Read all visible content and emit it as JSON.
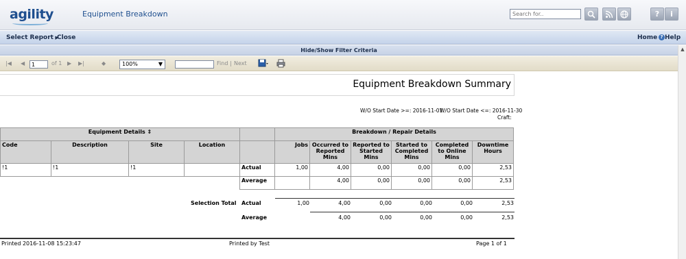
{
  "header": {
    "logo_text": "agility",
    "title": "Equipment Breakdown",
    "search_placeholder": "Search for..",
    "icons": [
      "search-icon",
      "rss-icon",
      "globe-icon",
      "help-icon",
      "info-icon"
    ]
  },
  "menu": {
    "select_report": "Select Report",
    "close": "Close",
    "home": "Home",
    "help": "Help"
  },
  "filter_bar": "Hide/Show Filter Criteria",
  "toolbar": {
    "page": "1",
    "of_label": "of 1",
    "zoom": "100%",
    "find": "Find",
    "separator": "|",
    "next": "Next"
  },
  "report": {
    "title": "Equipment Breakdown Summary",
    "start_date_from": "W/O Start Date >=: 2016-11-01",
    "start_date_to": "W/O Start Date <=: 2016-11-30",
    "craft": "Craft:",
    "group_headers": {
      "equipment": "Equipment Details",
      "breakdown": "Breakdown / Repair Details"
    },
    "columns": {
      "code": "Code",
      "description": "Description",
      "site": "Site",
      "location": "Location",
      "jobs": "Jobs",
      "occurred": "Occurred to Reported Mins",
      "reported": "Reported to Started Mins",
      "started": "Started to Completed Mins",
      "completed": "Completed to Online Mins",
      "downtime": "Downtime Hours"
    },
    "row": {
      "code": "!1",
      "description": "!1",
      "site": "!1",
      "location": "",
      "actual_label": "Actual",
      "actual": [
        "1,00",
        "4,00",
        "0,00",
        "0,00",
        "0,00",
        "2,53"
      ],
      "average_label": "Average",
      "average": [
        "",
        "4,00",
        "0,00",
        "0,00",
        "0,00",
        "2,53"
      ]
    },
    "totals": {
      "label": "Selection Total",
      "actual_label": "Actual",
      "actual": [
        "1,00",
        "4,00",
        "0,00",
        "0,00",
        "0,00",
        "2,53"
      ],
      "average_label": "Average",
      "average": [
        "4,00",
        "0,00",
        "0,00",
        "0,00",
        "2,53"
      ]
    },
    "footer": {
      "printed": "Printed 2016-11-08 15:23:47",
      "printed_by": "Printed by Test",
      "page": "Page 1 of 1"
    }
  }
}
